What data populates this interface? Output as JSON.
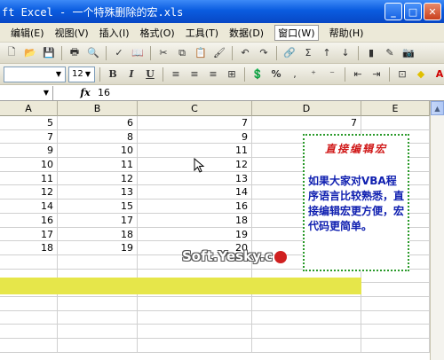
{
  "window": {
    "title": "ft Excel - 一个特殊删除的宏.xls"
  },
  "menu": [
    "编辑(E)",
    "视图(V)",
    "插入(I)",
    "格式(O)",
    "工具(T)",
    "数据(D)",
    "窗口(W)",
    "帮助(H)"
  ],
  "format_toolbar": {
    "font_size": "12",
    "bold": "B",
    "italic": "I",
    "underline": "U",
    "percent": "%"
  },
  "formula_bar": {
    "fx_label": "fx",
    "value": "16"
  },
  "columns": [
    "A",
    "B",
    "C",
    "D",
    "E"
  ],
  "rows": [
    [
      "5",
      "6",
      "7",
      "7",
      ""
    ],
    [
      "7",
      "8",
      "9",
      "",
      ""
    ],
    [
      "9",
      "10",
      "11",
      "",
      ""
    ],
    [
      "10",
      "11",
      "12",
      "",
      ""
    ],
    [
      "11",
      "12",
      "13",
      "",
      ""
    ],
    [
      "12",
      "13",
      "14",
      "",
      ""
    ],
    [
      "14",
      "15",
      "16",
      "",
      ""
    ],
    [
      "16",
      "17",
      "18",
      "",
      ""
    ],
    [
      "17",
      "18",
      "19",
      "",
      ""
    ],
    [
      "18",
      "19",
      "20",
      "",
      ""
    ],
    [
      "",
      "",
      "",
      "",
      ""
    ],
    [
      "",
      "",
      "",
      "",
      ""
    ],
    [
      "",
      "",
      "",
      "",
      ""
    ],
    [
      "",
      "",
      "",
      "",
      ""
    ],
    [
      "",
      "",
      "",
      "",
      ""
    ],
    [
      "",
      "",
      "",
      "",
      ""
    ],
    [
      "",
      "",
      "",
      "",
      ""
    ]
  ],
  "note": {
    "title": "直接编辑宏",
    "body": "如果大家对VBA程序语言比较熟悉，直接编辑宏更方便，宏代码更简单。"
  },
  "watermark": "Soft.Yesky.c",
  "colors": {
    "title_bar": "#0a5ce0",
    "highlight_row": "#e6e64a",
    "note_border": "#2a9a2a",
    "note_title": "#d01818",
    "note_body": "#1020b0"
  }
}
